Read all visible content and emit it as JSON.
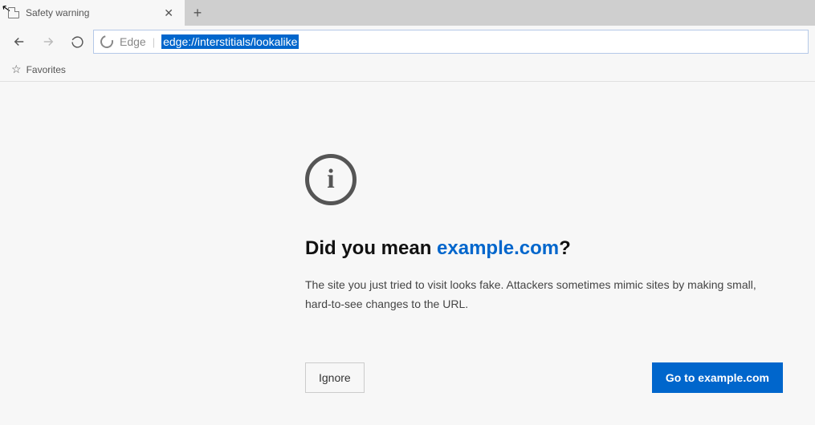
{
  "tab": {
    "title": "Safety warning"
  },
  "omnibox": {
    "provider_label": "Edge",
    "url": "edge://interstitials/lookalike"
  },
  "favorites": {
    "label": "Favorites"
  },
  "page": {
    "headline_prefix": "Did you mean ",
    "headline_link": "example.com",
    "headline_suffix": "?",
    "body": "The site you just tried to visit looks fake. Attackers sometimes mimic sites by making small, hard-to-see changes to the URL.",
    "ignore_label": "Ignore",
    "go_label": "Go to example.com"
  }
}
